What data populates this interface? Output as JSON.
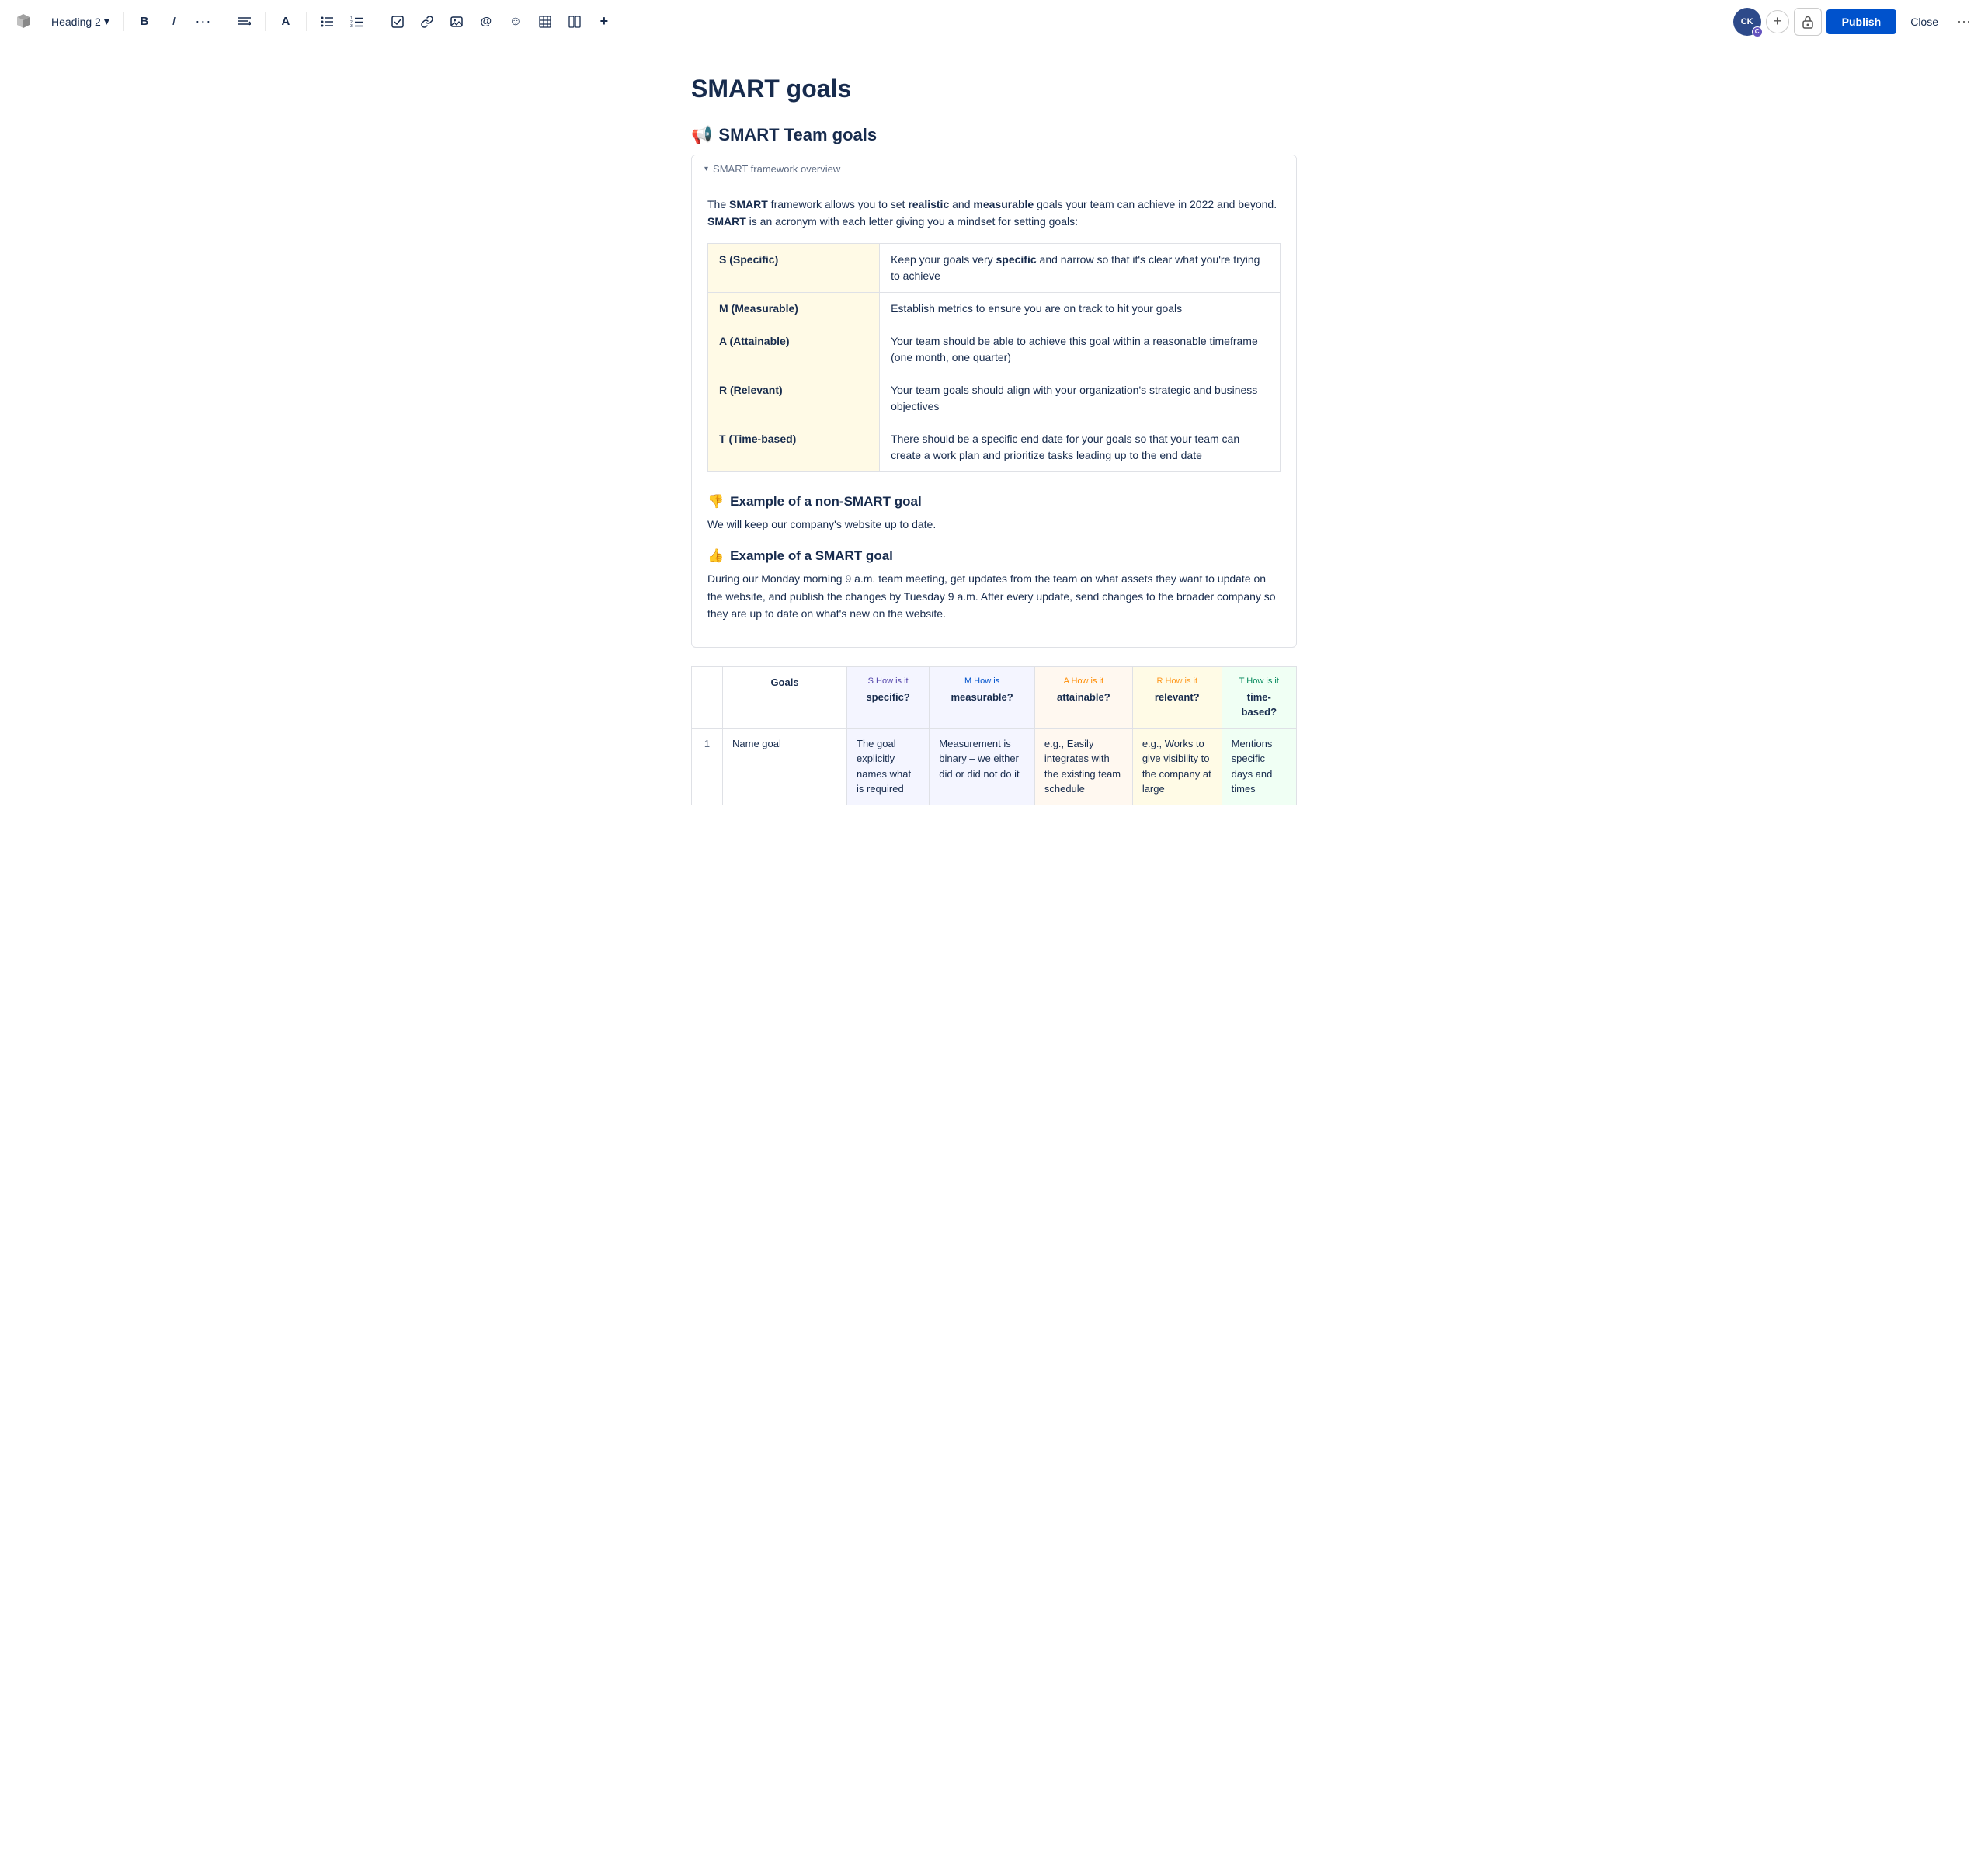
{
  "toolbar": {
    "heading_select": "Heading 2",
    "chevron_down": "▾",
    "bold_label": "B",
    "italic_label": "I",
    "more_format_label": "···",
    "align_label": "≡",
    "color_label": "A",
    "bullet_label": "⁝",
    "ordered_label": "⁝",
    "task_label": "☑",
    "link_label": "⛓",
    "image_label": "🖼",
    "mention_label": "@",
    "emoji_label": "☺",
    "table_label": "⊞",
    "columns_label": "⬚",
    "plus_label": "+",
    "avatar_initials": "CK",
    "avatar_badge": "C",
    "add_label": "+",
    "publish_label": "Publish",
    "close_label": "Close",
    "more_label": "···"
  },
  "page": {
    "title": "SMART goals"
  },
  "section1": {
    "icon": "📢",
    "heading": "SMART Team goals",
    "expand_label": "SMART framework overview",
    "intro": {
      "text_before": "The ",
      "bold1": "SMART",
      "text_mid1": " framework allows you to set ",
      "bold2": "realistic",
      "text_mid2": " and ",
      "bold3": "measurable",
      "text_mid3": " goals your team can achieve in 2022 and beyond. ",
      "bold4": "SMART",
      "text_after": " is an acronym with each letter giving you a mindset for setting goals:"
    },
    "smart_table": [
      {
        "letter": "S (Specific)",
        "desc": "Keep your goals very specific and narrow so that it's clear what you're trying to achieve"
      },
      {
        "letter": "M (Measurable)",
        "desc": "Establish metrics to ensure you are on track to hit your goals"
      },
      {
        "letter": "A (Attainable)",
        "desc": "Your team should be able to achieve this goal within a reasonable timeframe (one month, one quarter)"
      },
      {
        "letter": "R (Relevant)",
        "desc": "Your team goals should align with your organization's strategic and business objectives"
      },
      {
        "letter": "T (Time-based)",
        "desc": "There should be a specific end date for your goals so that your team can create a work plan and prioritize tasks leading up to the end date"
      }
    ],
    "non_smart": {
      "icon": "👎",
      "heading": "Example of a non-SMART goal",
      "body": "We will keep our company's website up to date."
    },
    "smart_goal": {
      "icon": "👍",
      "heading": "Example of a SMART goal",
      "body": "During our Monday morning 9 a.m. team meeting, get updates from the team on what assets they want to update on the website, and publish the changes by Tuesday 9 a.m. After every update, send changes to the broader company so they are up to date on what's new on the website."
    }
  },
  "goals_table": {
    "headers": [
      {
        "id": "num",
        "label": ""
      },
      {
        "id": "goals",
        "label": "Goals"
      },
      {
        "id": "s",
        "prefix": "S",
        "main": "How is it",
        "bold": "specific?",
        "color_class": "col-label-s",
        "bg_class": "col-s"
      },
      {
        "id": "m",
        "prefix": "M",
        "main": "How is",
        "bold": "measurable?",
        "color_class": "col-label-m",
        "bg_class": "col-m"
      },
      {
        "id": "a",
        "prefix": "A",
        "main": "How is it",
        "bold": "attainable?",
        "color_class": "col-label-a",
        "bg_class": "col-a"
      },
      {
        "id": "r",
        "prefix": "R",
        "main": "How is it",
        "bold": "relevant?",
        "color_class": "col-label-r",
        "bg_class": "col-r"
      },
      {
        "id": "t",
        "prefix": "T",
        "main": "How is it",
        "bold": "time-based?",
        "color_class": "col-label-t",
        "bg_class": "col-t"
      }
    ],
    "rows": [
      {
        "num": "1",
        "goals": "Name goal",
        "s": "The goal explicitly names what is required",
        "m": "Measurement is binary – we either did or did not do it",
        "a": "e.g., Easily integrates with the existing team schedule",
        "r": "e.g., Works to give visibility to the company at large",
        "t": "Mentions specific days and times"
      }
    ]
  }
}
